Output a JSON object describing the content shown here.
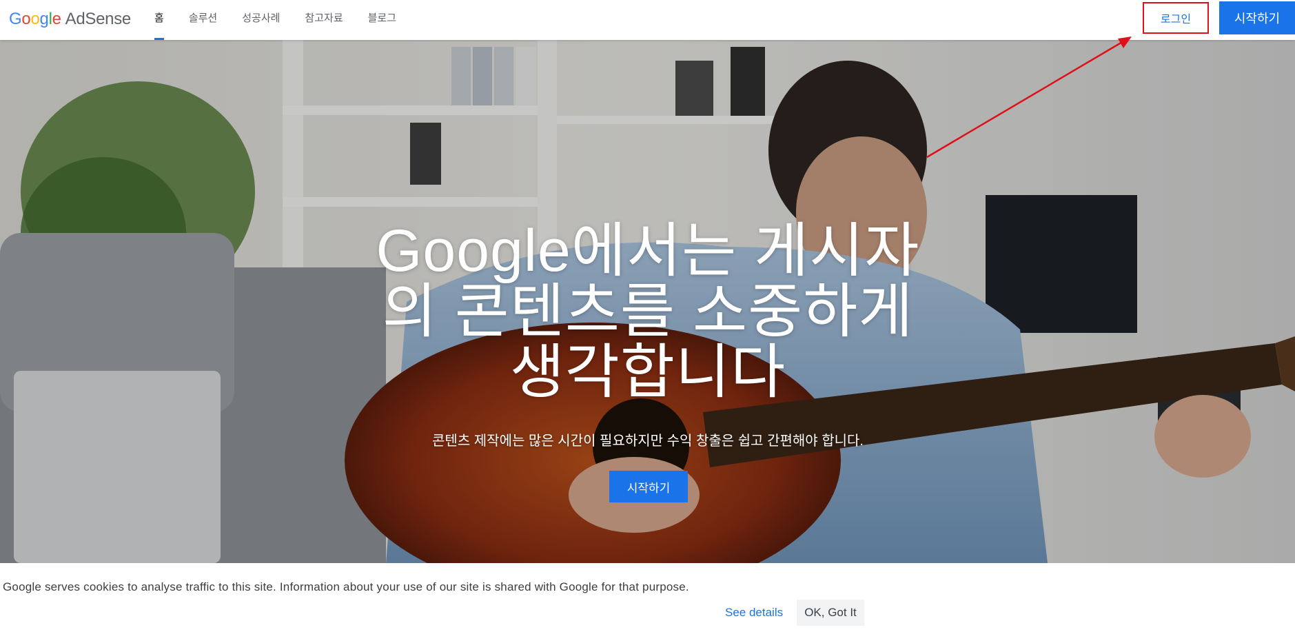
{
  "header": {
    "logo": {
      "google": "Google",
      "product": "AdSense"
    },
    "nav": [
      {
        "label": "홈",
        "active": true
      },
      {
        "label": "솔루션",
        "active": false
      },
      {
        "label": "성공사례",
        "active": false
      },
      {
        "label": "참고자료",
        "active": false
      },
      {
        "label": "블로그",
        "active": false
      }
    ],
    "login_label": "로그인",
    "start_label": "시작하기"
  },
  "hero": {
    "headline_lines": [
      "Google에서는 게시자",
      "의 콘텐츠를 소중하게",
      "생각합니다"
    ],
    "subtitle": "콘텐츠 제작에는 많은 시간이 필요하지만 수익 창출은 쉽고 간편해야 합니다.",
    "cta_label": "시작하기"
  },
  "cookie_bar": {
    "message": "Google serves cookies to analyse traffic to this site. Information about your use of our site is shared with Google for that purpose.",
    "details_label": "See details",
    "ok_label": "OK, Got It"
  },
  "colors": {
    "accent_blue": "#1a73e8",
    "annotation_red": "#e0101a"
  }
}
